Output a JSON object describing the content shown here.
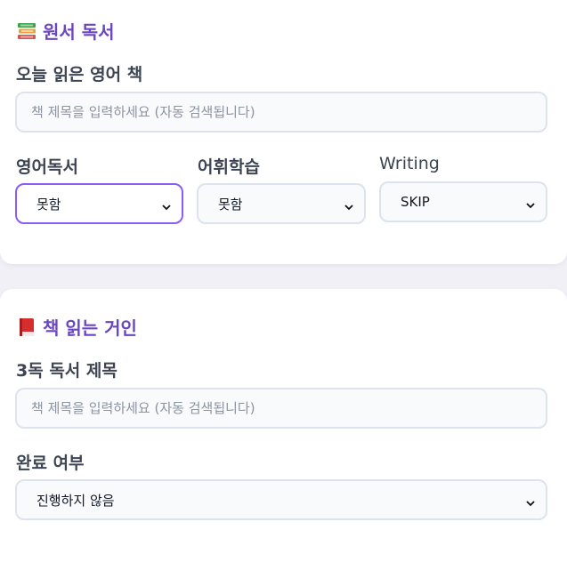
{
  "section1": {
    "icon": "books-icon",
    "title": "원서 독서",
    "book_label": "오늘 읽은 영어 책",
    "book_placeholder": "책 제목을 입력하세요 (자동 검색됩니다)",
    "fields": [
      {
        "label": "영어독서",
        "value": "못함"
      },
      {
        "label": "어휘학습",
        "value": "못함"
      },
      {
        "label": "Writing",
        "value": "SKIP"
      }
    ]
  },
  "section2": {
    "icon": "red-book-icon",
    "title": "책 읽는 거인",
    "book_label": "3독 독서 제목",
    "book_placeholder": "책 제목을 입력하세요 (자동 검색됩니다)",
    "status_label": "완료 여부",
    "status_value": "진행하지 않음"
  },
  "colors": {
    "accent": "#6b46c1",
    "focus_border": "#8b5cf6",
    "label": "#3d4452"
  }
}
